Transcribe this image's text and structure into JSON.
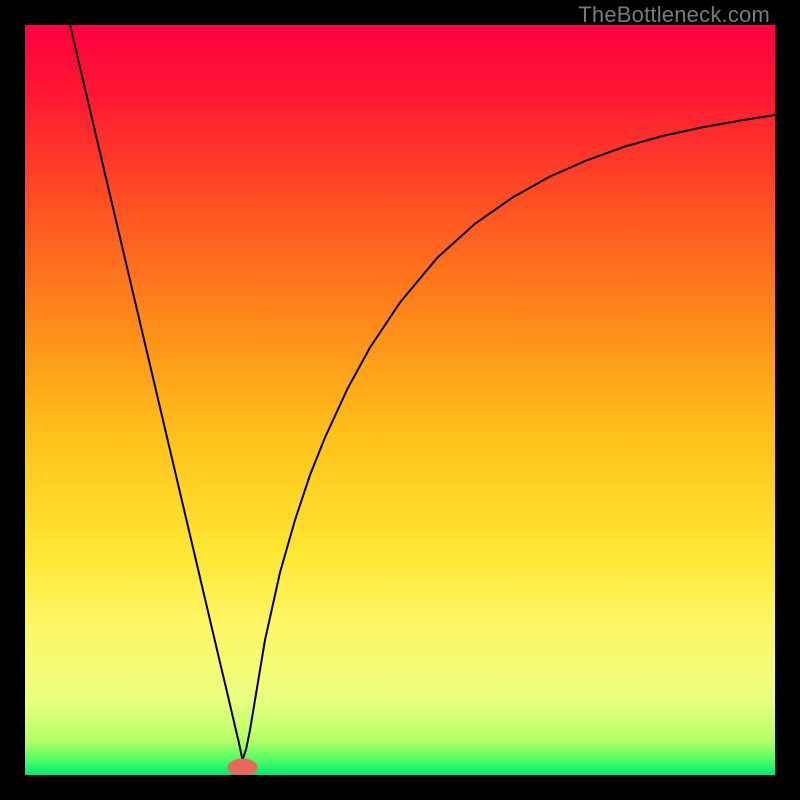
{
  "watermark": "TheBottleneck.com",
  "chart_data": {
    "type": "line",
    "title": "",
    "xlabel": "",
    "ylabel": "",
    "xlim": [
      0,
      100
    ],
    "ylim": [
      0,
      100
    ],
    "grid": false,
    "legend": false,
    "background_gradient": {
      "stops": [
        {
          "offset": 0.0,
          "color": "#ff0040"
        },
        {
          "offset": 0.1,
          "color": "#ff1a33"
        },
        {
          "offset": 0.25,
          "color": "#ff5522"
        },
        {
          "offset": 0.4,
          "color": "#ff8c1a"
        },
        {
          "offset": 0.55,
          "color": "#ffc21a"
        },
        {
          "offset": 0.7,
          "color": "#ffe633"
        },
        {
          "offset": 0.8,
          "color": "#fff766"
        },
        {
          "offset": 0.9,
          "color": "#eaff80"
        },
        {
          "offset": 0.955,
          "color": "#b4ff66"
        },
        {
          "offset": 0.98,
          "color": "#4dff66"
        },
        {
          "offset": 1.0,
          "color": "#00e873"
        }
      ]
    },
    "series": [
      {
        "name": "vcurve",
        "stroke": "#000000",
        "stroke_width": 2,
        "x": [
          6.0,
          8.0,
          10.0,
          12.0,
          14.0,
          16.0,
          18.0,
          20.0,
          22.0,
          24.0,
          26.0,
          27.0,
          28.0,
          28.5,
          29.0,
          29.5,
          30.0,
          31.0,
          32.0,
          34.0,
          36.0,
          38.0,
          40.0,
          43.0,
          46.0,
          50.0,
          55.0,
          60.0,
          65.0,
          70.0,
          75.0,
          80.0,
          85.0,
          90.0,
          95.0,
          100.0
        ],
        "y": [
          100.0,
          91.5,
          83.0,
          74.5,
          66.0,
          57.5,
          49.0,
          40.5,
          32.0,
          23.5,
          15.0,
          10.8,
          6.5,
          4.4,
          2.0,
          3.5,
          6.0,
          12.0,
          18.0,
          27.0,
          34.0,
          40.0,
          45.0,
          51.5,
          57.0,
          63.0,
          69.0,
          73.5,
          77.0,
          79.8,
          82.0,
          83.8,
          85.2,
          86.3,
          87.2,
          88.0
        ]
      }
    ],
    "marker": {
      "name": "bottleneck-marker",
      "x": 29.0,
      "y": 1.0,
      "rx": 2.0,
      "ry": 1.2,
      "fill": "#e46a5e"
    }
  }
}
